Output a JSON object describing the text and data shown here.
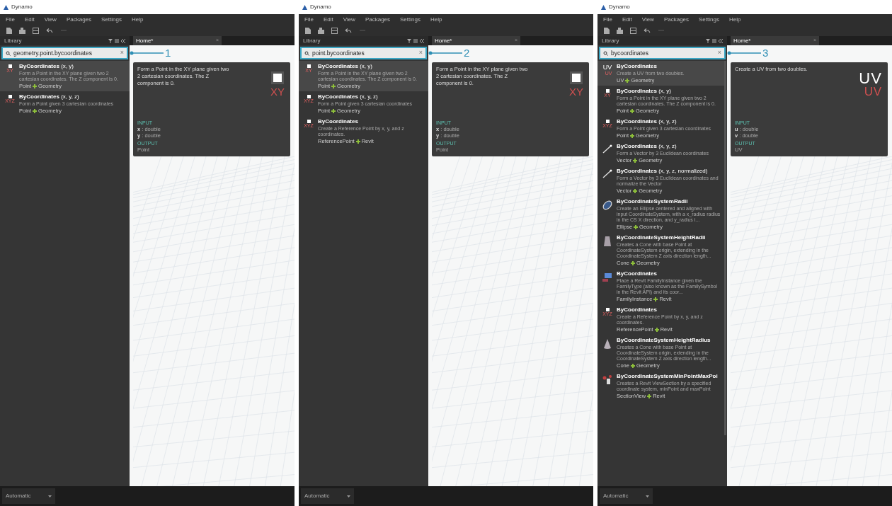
{
  "windows": [
    {
      "title": "Dynamo",
      "menu": [
        "File",
        "Edit",
        "View",
        "Packages",
        "Settings",
        "Help"
      ],
      "library_label": "Library",
      "tab": {
        "label": "Home*",
        "close": "×"
      },
      "search": {
        "value": "geometry.point.bycoordinates",
        "clear": "×"
      },
      "callout": "1",
      "results": [
        {
          "title": "**ByCoordinates** (x, y)",
          "description": "Form a Point in the XY plane given two 2 cartesian coordinates. The Z component is 0.",
          "icon": {
            "kind": "point",
            "text": "XY"
          },
          "category": "Point",
          "library": "Geometry",
          "selected": true
        },
        {
          "title": "**ByCoordinates** (x, y, z)",
          "description": "Form a Point given 3 cartesian coordinates",
          "icon": {
            "kind": "point",
            "text": "XYZ"
          },
          "category": "Point",
          "library": "Geometry",
          "selected": false
        }
      ],
      "detail": {
        "description": "Form a Point in the XY plane given two 2 cartesian coordinates. The Z component is 0.",
        "icon": {
          "kind": "point",
          "text": "XY"
        },
        "input_label": "INPUT",
        "inputs": [
          {
            "name": "x",
            "type": " : double"
          },
          {
            "name": "y",
            "type": " : double"
          }
        ],
        "output_label": "OUTPUT",
        "output": "Point"
      },
      "run_mode": "Automatic"
    },
    {
      "title": "Dynamo",
      "menu": [
        "File",
        "Edit",
        "View",
        "Packages",
        "Settings",
        "Help"
      ],
      "library_label": "Library",
      "tab": {
        "label": "Home*",
        "close": "×"
      },
      "search": {
        "value": "point.bycoordinates",
        "clear": "×"
      },
      "callout": "2",
      "results": [
        {
          "title": "**ByCoordinates** (x, y)",
          "description": "Form a Point in the XY plane given two 2 cartesian coordinates. The Z component is 0.",
          "icon": {
            "kind": "point",
            "text": "XY"
          },
          "category": "Point",
          "library": "Geometry",
          "selected": true
        },
        {
          "title": "**ByCoordinates** (x, y, z)",
          "description": "Form a Point given 3 cartesian coordinates",
          "icon": {
            "kind": "point",
            "text": "XYZ"
          },
          "category": "Point",
          "library": "Geometry",
          "selected": false
        },
        {
          "title": "**ByCoordinates**",
          "description": "Create a Reference Point by x, y, and z coordinates.",
          "icon": {
            "kind": "point",
            "text": "XYZ"
          },
          "category": "ReferencePoint",
          "library": "Revit",
          "selected": false
        }
      ],
      "detail": {
        "description": "Form a Point in the XY plane given two 2 cartesian coordinates. The Z component is 0.",
        "icon": {
          "kind": "point",
          "text": "XY"
        },
        "input_label": "INPUT",
        "inputs": [
          {
            "name": "x",
            "type": " : double"
          },
          {
            "name": "y",
            "type": " : double"
          }
        ],
        "output_label": "OUTPUT",
        "output": "Point"
      },
      "run_mode": "Automatic"
    },
    {
      "title": "Dynamo",
      "menu": [
        "File",
        "Edit",
        "View",
        "Packages",
        "Settings",
        "Help"
      ],
      "library_label": "Library",
      "tab": {
        "label": "Home*",
        "close": "×"
      },
      "search": {
        "value": "bycoordinates",
        "clear": "×"
      },
      "callout": "3",
      "results": [
        {
          "title": "**ByCoordinates**",
          "description": "Create a UV from two doubles.",
          "icon": {
            "kind": "uv",
            "text": "UV",
            "subtext": "UV"
          },
          "category": "UV",
          "library": "Geometry",
          "selected": true
        },
        {
          "title": "**ByCoordinates** (x, y)",
          "description": "Form a Point in the XY plane given two 2 cartesian coordinates. The Z component is 0.",
          "icon": {
            "kind": "point",
            "text": "XY"
          },
          "category": "Point",
          "library": "Geometry",
          "selected": false
        },
        {
          "title": "**ByCoordinates** (x, y, z)",
          "description": "Form a Point given 3 cartesian coordinates",
          "icon": {
            "kind": "point",
            "text": "XYZ"
          },
          "category": "Point",
          "library": "Geometry",
          "selected": false
        },
        {
          "title": "**ByCoordinates** (x, y, z)",
          "description": "Form a Vector by 3 Euclidean coordinates",
          "icon": {
            "kind": "vector"
          },
          "category": "Vector",
          "library": "Geometry",
          "selected": false
        },
        {
          "title": "**ByCoordinates** (x, y, z, normalized)",
          "description": "Form a Vector by 3 Euclidean coordinates and normalize the Vector",
          "icon": {
            "kind": "vector"
          },
          "category": "Vector",
          "library": "Geometry",
          "selected": false
        },
        {
          "title": "**ByCoordinateSystemRadii**",
          "description": "Create an Ellipse centered and aligned with input CoordinateSystem, with a x_radius radius in the CS X direction, and y_radius i...",
          "icon": {
            "kind": "ellipse"
          },
          "category": "Ellipse",
          "library": "Geometry",
          "selected": false
        },
        {
          "title": "**ByCoordinateSystemHeightRadii**",
          "description": "Creates a Cone with base Point at CoordinateSystem origin, extending in the CoordinateSystem Z axis direction length...",
          "icon": {
            "kind": "cylinder"
          },
          "category": "Cone",
          "library": "Geometry",
          "selected": false
        },
        {
          "title": "**ByCoordinates**",
          "description": "Place a Revit FamilyInstance given the FamilyType (also known as the FamilySymbol in the Revit API) and its coor...",
          "icon": {
            "kind": "family"
          },
          "category": "FamilyInstance",
          "library": "Revit",
          "selected": false
        },
        {
          "title": "**ByCoordinates**",
          "description": "Create a Reference Point by x, y, and z coordinates.",
          "icon": {
            "kind": "point",
            "text": "XYZ"
          },
          "category": "ReferencePoint",
          "library": "Revit",
          "selected": false
        },
        {
          "title": "**ByCoordinateSystemHeightRadius**",
          "description": "Creates a Cone with base Point at CoordinateSystem origin, extending in the CoordinateSystem Z axis direction length...",
          "icon": {
            "kind": "cone"
          },
          "category": "Cone",
          "library": "Geometry",
          "selected": false
        },
        {
          "title": "**ByCoordinateSystemMinPointMaxPoi**",
          "description": "Creates a Revit ViewSection by a specified coordinate system, minPoint and maxPoint",
          "icon": {
            "kind": "section"
          },
          "category": "SectionView",
          "library": "Revit",
          "selected": false
        }
      ],
      "detail": {
        "description": "Create a UV from two doubles.",
        "icon": {
          "kind": "uv",
          "text": "UV",
          "subtext": "UV"
        },
        "input_label": "INPUT",
        "inputs": [
          {
            "name": "u",
            "type": " : double"
          },
          {
            "name": "v",
            "type": " : double"
          }
        ],
        "output_label": "OUTPUT",
        "output": "UV"
      },
      "run_mode": "Automatic"
    }
  ]
}
